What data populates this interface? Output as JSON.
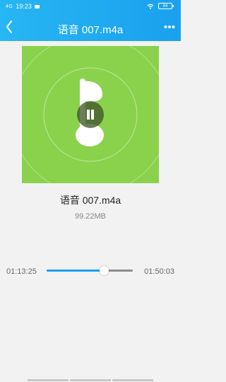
{
  "status_bar": {
    "signal": "4G",
    "time": "19:23",
    "battery": "84"
  },
  "header": {
    "title": "语音 007.m4a",
    "back_icon": "chevron-left-icon",
    "more_icon": "more-dots-icon",
    "colors": {
      "gradient_start": "#27b6f3",
      "gradient_end": "#1aa0ee"
    }
  },
  "player": {
    "cover_color": "#8ad24c",
    "cover_icon": "music-note-icon",
    "state_icon": "pause-icon",
    "track_name": "语音 007.m4a",
    "file_size": "99.22MB",
    "current_time": "01:13:25",
    "total_time": "01:50:03",
    "progress": 0.667,
    "accent_color": "#1aa0ee"
  }
}
